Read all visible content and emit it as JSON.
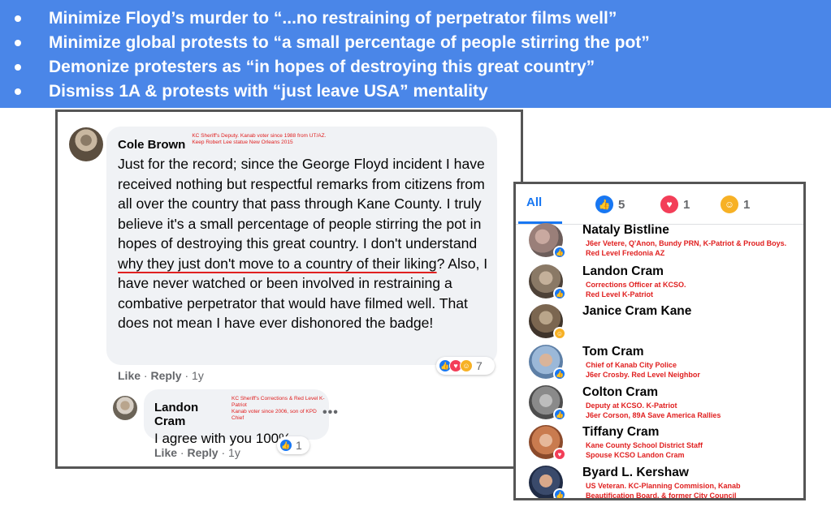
{
  "banner": {
    "items": [
      "Minimize Floyd’s murder to “...no restraining of perpetrator films well”",
      "Minimize global protests to “a small percentage of people stirring the pot”",
      "Demonize protesters as “in hopes of destroying this great country”",
      "Dismiss 1A & protests with “just leave USA” mentality"
    ]
  },
  "comment": {
    "author": "Cole Brown",
    "note_line1": "KC Sheriff's Deputy.  Kanab voter since 1988 from UT/AZ.",
    "note_line2": "Keep Robert Lee statue New Orleans 2015",
    "text_before": "Just for the record; since the George Floyd incident I have received nothing but respectful remarks from citizens from all over the country that pass through Kane County. I truly believe it's a small percentage of people stirring the pot in hopes of destroying this great country. I don't understand ",
    "text_underlined": "why they just don't move to a country of their liking",
    "text_after": "? Also, I have never watched or been involved in restraining a combative perpetrator that would have filmed well. That does not mean I have ever dishonored the badge!",
    "like_label": "Like",
    "reply_label": "Reply",
    "time": "1y",
    "reaction_count": "7"
  },
  "reply": {
    "author": "Landon Cram",
    "note_line1": "KC Sheriff's Corrections & Red Level K-Patriot",
    "note_line2": "Kanab voter since 2006, son of KPD Chief",
    "text": "I agree with you 100%",
    "more": "•••",
    "like_label": "Like",
    "reply_label": "Reply",
    "time": "1y",
    "reaction_count": "1"
  },
  "reactions": {
    "tabs": {
      "all": "All",
      "like_count": "5",
      "love_count": "1",
      "care_count": "1"
    },
    "people": [
      {
        "name": "Nataly Bistline",
        "note1": "J6er Vetere, Q'Anon, Bundy PRN, K-Patriot & Proud Boys.",
        "note2": "Red Level Fredonia AZ",
        "reaction": "like"
      },
      {
        "name": "Landon Cram",
        "note1": "Corrections Officer at KCSO.",
        "note2": "Red Level K-Patriot",
        "reaction": "like"
      },
      {
        "name": "Janice Cram Kane",
        "note1": "",
        "note2": "",
        "reaction": "care"
      },
      {
        "name": "Tom Cram",
        "note1": "Chief of Kanab City Police",
        "note2": "J6er Crosby.  Red Level Neighbor",
        "reaction": "like"
      },
      {
        "name": "Colton Cram",
        "note1": "Deputy at KCSO.  K-Patriot",
        "note2": "J6er Corson, 89A Save America Rallies",
        "reaction": "like"
      },
      {
        "name": "Tiffany Cram",
        "note1": "Kane County School District Staff",
        "note2": "Spouse KCSO Landon Cram",
        "reaction": "love"
      },
      {
        "name": "Byard L. Kershaw",
        "note1": "US Veteran.  KC-Planning Commision, Kanab",
        "note2": "Beautification Board. & former City Council",
        "reaction": "like"
      }
    ]
  },
  "colors": {
    "banner_bg": "#4a86e8",
    "annotation_red": "#e02020",
    "facebook_blue": "#1877f2",
    "love_red": "#f33e58",
    "care_yellow": "#f7b125"
  }
}
